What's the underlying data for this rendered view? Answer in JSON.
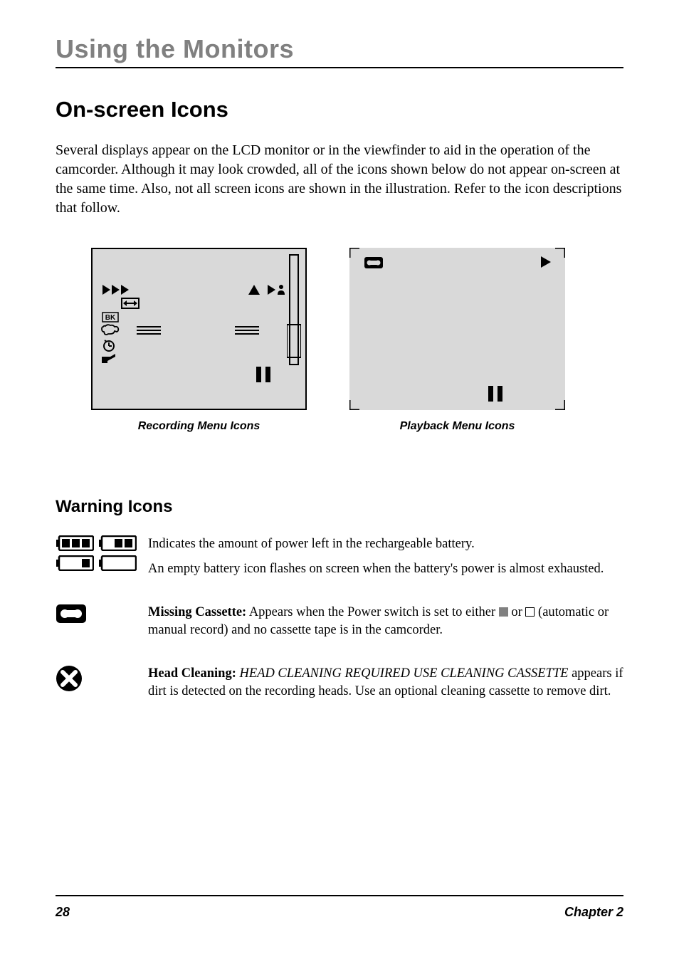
{
  "chapter_title": "Using the Monitors",
  "section_title": "On-screen Icons",
  "intro_text": "Several displays appear on the LCD monitor or in the viewfinder to aid in the operation of the camcorder. Although it may look crowded, all of the icons shown below do not appear on-screen at the same time. Also, not all screen icons are shown in the illustration. Refer to the icon descriptions that follow.",
  "captions": {
    "recording": "Recording Menu Icons",
    "playback": "Playback Menu Icons"
  },
  "subsection_title": "Warning Icons",
  "warnings": {
    "battery": {
      "line1": "Indicates the amount of power left in the rechargeable battery.",
      "line2": "An empty battery icon flashes on screen when the battery's power is almost exhausted."
    },
    "cassette": {
      "label": "Missing Cassette:",
      "text1": " Appears when the Power switch is set to either ",
      "text2": " or ",
      "text3": " (automatic or manual record) and no cassette tape is in the camcorder."
    },
    "head": {
      "label": "Head Cleaning:",
      "italic": " HEAD CLEANING REQUIRED USE CLEANING CASSETTE",
      "text": " appears if dirt is detected on the recording heads. Use an optional cleaning cassette to remove dirt."
    }
  },
  "footer": {
    "page": "28",
    "chapter": "Chapter 2"
  },
  "icon_names": {
    "triple_play": "triple-play-icon",
    "bk": "BK",
    "double_arrow": "double-arrow-icon",
    "timer": "timer-icon",
    "eject": "eject-icon",
    "pause": "pause-icon",
    "triangle_up": "triangle-up-icon",
    "play_person": "play-person-icon",
    "cassette": "cassette-icon",
    "play": "play-icon",
    "lines": "lines-icon"
  }
}
